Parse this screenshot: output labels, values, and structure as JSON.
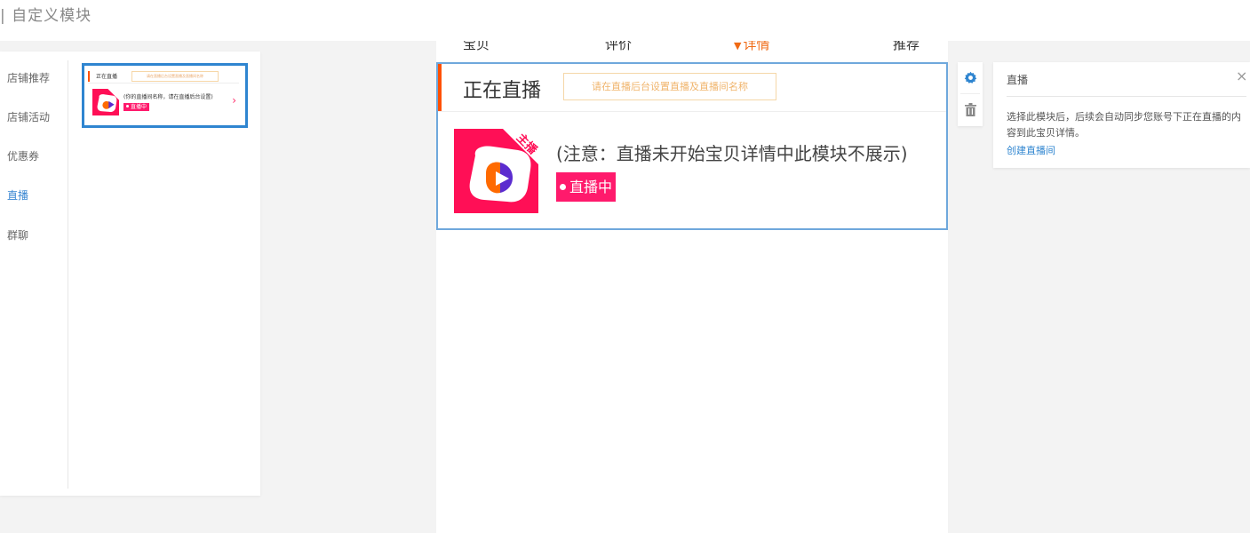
{
  "header": {
    "title": "| 自定义模块"
  },
  "sidebar": {
    "categories": [
      {
        "label": "店铺推荐"
      },
      {
        "label": "店铺活动"
      },
      {
        "label": "优惠券"
      },
      {
        "label": "直播",
        "active": true
      },
      {
        "label": "群聊"
      }
    ],
    "thumbnail": {
      "title": "正在直播",
      "input_placeholder": "请在直播后台设置直播及直播间名称",
      "note": "(你的直播间名称，请在直播后台设置)",
      "live_badge": "直播中",
      "arrow": "›"
    }
  },
  "preview": {
    "tabs": [
      {
        "label": "宝贝"
      },
      {
        "label": "评价"
      },
      {
        "label": "详情",
        "active": true,
        "marker": "▼"
      },
      {
        "label": "推荐"
      }
    ],
    "module": {
      "title": "正在直播",
      "input_placeholder": "请在直播后台设置直播及直播间名称",
      "note": "(注意：直播未开始宝贝详情中此模块不展示)",
      "live_badge": "直播中",
      "ribbon": "主播"
    }
  },
  "tools": {
    "settings_icon": "gear-icon",
    "delete_icon": "trash-icon"
  },
  "settings_panel": {
    "title": "直播",
    "close": "×",
    "description": "选择此模块后，后续会自动同步您账号下正在直播的内容到此宝贝详情。",
    "link": "创建直播间"
  },
  "colors": {
    "accent": "#ff5000",
    "brand_pink": "#ff0f56",
    "live_badge": "#ff1a6c",
    "selection": "#2f85d0",
    "active_tab": "#f06a14"
  }
}
